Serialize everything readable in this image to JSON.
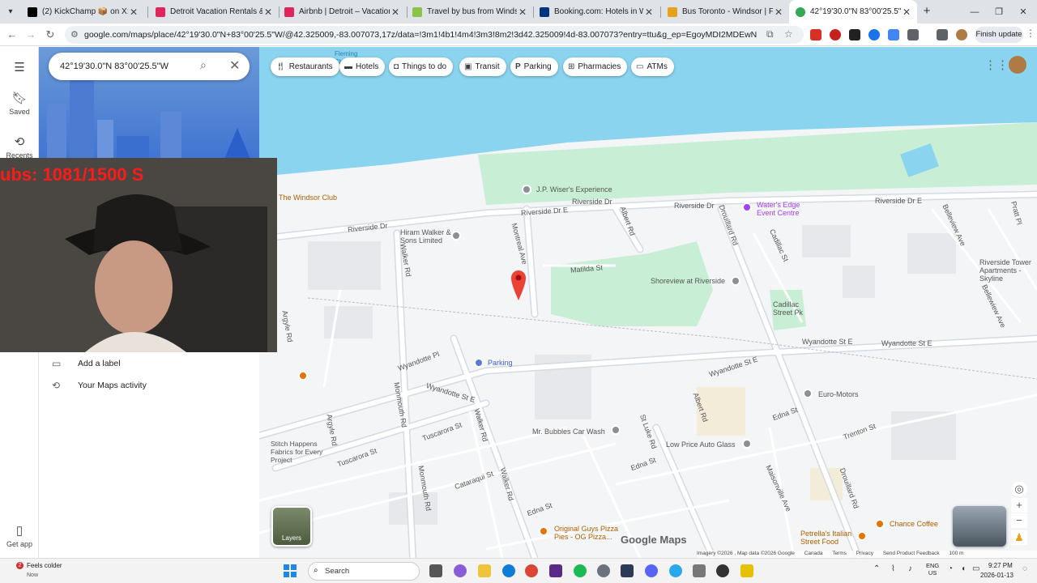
{
  "browser": {
    "tabs": [
      {
        "label": "(2) KickChamp 📦 on X: \"Fans a",
        "color": "#000000"
      },
      {
        "label": "Detroit Vacation Rentals & Hon",
        "color": "#e0245e"
      },
      {
        "label": "Airbnb | Detroit – Vacation Ren",
        "color": "#e0245e"
      },
      {
        "label": "Travel by bus from Windsor, ON",
        "color": "#8bc34a"
      },
      {
        "label": "Booking.com: Hotels in Windso",
        "color": "#003580"
      },
      {
        "label": "Bus Toronto - Windsor | Find th",
        "color": "#e3a21a"
      },
      {
        "label": "42°19'30.0\"N 83°00'25.5\"W - G",
        "color": "#34a853"
      }
    ],
    "url": "google.com/maps/place/42°19'30.0\"N+83°00'25.5\"W/@42.325009,-83.007073,17z/data=!3m1!4b1!4m4!3m3!8m2!3d42.325009!4d-83.007073?entry=ttu&g_ep=EgoyMDI2MDEwNy4wIKXMDSoASAFQA...",
    "finish_update": "Finish update",
    "new_tab": "+"
  },
  "sidebar": {
    "items": [
      {
        "label": "Saved",
        "icon": "bookmark-icon"
      },
      {
        "label": "Recents",
        "icon": "history-icon"
      },
      {
        "label": "Get app",
        "icon": "phone-icon"
      }
    ]
  },
  "panel": {
    "search_value": "42°19'30.0\"N 83°00'25.5\"W",
    "items": [
      {
        "label": "Add a label",
        "icon": "label-icon"
      },
      {
        "label": "Your Maps activity",
        "icon": "activity-icon"
      }
    ]
  },
  "overlay": {
    "text": "ubs: 1081/1500  S"
  },
  "chips": [
    {
      "label": "Restaurants",
      "icon": "restaurant-icon"
    },
    {
      "label": "Hotels",
      "icon": "hotel-icon"
    },
    {
      "label": "Things to do",
      "icon": "camera-icon"
    },
    {
      "label": "Transit",
      "icon": "transit-icon"
    },
    {
      "label": "Parking",
      "icon": "parking-icon"
    },
    {
      "label": "Pharmacies",
      "icon": "pharmacy-icon"
    },
    {
      "label": "ATMs",
      "icon": "atm-icon"
    }
  ],
  "map": {
    "streets": [
      "Riverside Dr E",
      "Riverside Dr",
      "Riverside Dr",
      "Riverside Dr E",
      "Riverside Dr",
      "Wyandotte St E",
      "Wyandotte St E",
      "Wyandotte St E",
      "Wyandotte St E",
      "Wyandotte Pl",
      "Walker Rd",
      "Walker Rd",
      "Montreal Ave",
      "Albert Rd",
      "Albert Rd",
      "Drouillard Rd",
      "Drouillard Rd",
      "Cadillac St",
      "Matilda St",
      "St Luke Rd",
      "Edna St",
      "Edna St",
      "Edna St",
      "Argyle Rd",
      "Argyle Rd",
      "Monmouth Rd",
      "Monmouth Rd",
      "Tuscarora St",
      "Tuscarora St",
      "Cataraqui St",
      "Walker Rd",
      "Belleview Ave",
      "Bellewiew Ave",
      "Maisonville Ave",
      "Trenton St",
      "Pratt Pl"
    ],
    "places": [
      "J.P. Wiser's Experience",
      "Water's Edge Event Centre",
      "Hiram Walker & Sons Limited",
      "Shoreview at Riverside",
      "Cadillac Street Pk",
      "The Windsor Club",
      "Parking",
      "Euro-Motors",
      "Mr. Bubbles Car Wash",
      "Low Price Auto Glass",
      "Stitch Happens Fabrics for Every Project",
      "Original Guys Pizza Pies - OG Pizza...",
      "Petrella's Italian Street Food",
      "Chance Coffee",
      "Riverside Tower Apartments - Skyline",
      "Fleming Channel"
    ],
    "layers_label": "Layers",
    "logo": "Google Maps",
    "attribution": [
      "Imagery ©2026 , Map data ©2026 Google",
      "Canada",
      "Terms",
      "Privacy",
      "Send Product Feedback",
      "100 m"
    ]
  },
  "taskbar": {
    "weather": "Feels colder",
    "weather_sub": "Now",
    "weather_badge": "2",
    "search_label": "Search",
    "lang_top": "ENG",
    "lang_bottom": "US",
    "time": "9:27 PM",
    "date": "2026-01-13"
  },
  "colors": {
    "water": "#8ad4f0",
    "land": "#f4f5f6",
    "park": "#c8efd6",
    "road": "#ffffff",
    "pin": "#ea4335"
  }
}
